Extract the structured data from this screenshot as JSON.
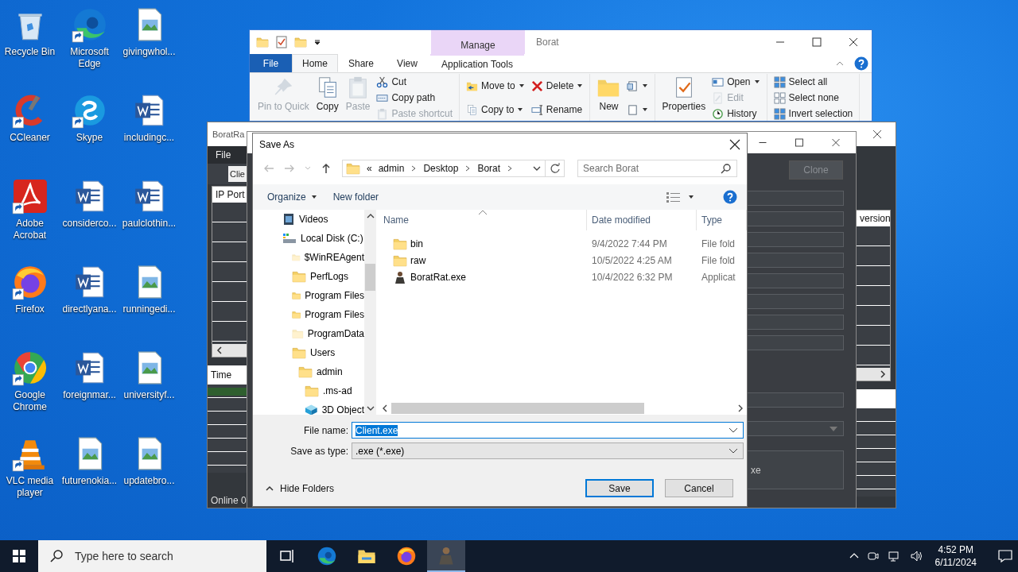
{
  "desktop": {
    "icons": [
      {
        "label": "Recycle Bin",
        "kind": "recycle",
        "shortcut": false
      },
      {
        "label": "Microsoft Edge",
        "kind": "edge",
        "shortcut": true
      },
      {
        "label": "givingwhol...",
        "kind": "image",
        "shortcut": false
      },
      {
        "label": "CCleaner",
        "kind": "ccleaner",
        "shortcut": true
      },
      {
        "label": "Skype",
        "kind": "skype",
        "shortcut": true
      },
      {
        "label": "includingc...",
        "kind": "word",
        "shortcut": false
      },
      {
        "label": "Adobe Acrobat",
        "kind": "acrobat",
        "shortcut": true
      },
      {
        "label": "considerco...",
        "kind": "word",
        "shortcut": false
      },
      {
        "label": "paulclothin...",
        "kind": "word",
        "shortcut": false
      },
      {
        "label": "Firefox",
        "kind": "firefox",
        "shortcut": true
      },
      {
        "label": "directlyana...",
        "kind": "word",
        "shortcut": false
      },
      {
        "label": "runningedi...",
        "kind": "image",
        "shortcut": false
      },
      {
        "label": "Google Chrome",
        "kind": "chrome",
        "shortcut": true
      },
      {
        "label": "foreignmar...",
        "kind": "word",
        "shortcut": false
      },
      {
        "label": "universityf...",
        "kind": "image",
        "shortcut": false
      },
      {
        "label": "VLC media player",
        "kind": "vlc",
        "shortcut": true
      },
      {
        "label": "futurenokia...",
        "kind": "image",
        "shortcut": false
      },
      {
        "label": "updatebro...",
        "kind": "image",
        "shortcut": false
      }
    ]
  },
  "explorer": {
    "title": "Borat",
    "contextual_tab": "Manage",
    "tabs": [
      {
        "label": "File",
        "kind": "file",
        "selected": false
      },
      {
        "label": "Home",
        "kind": "tab",
        "selected": true
      },
      {
        "label": "Share",
        "kind": "tab",
        "selected": false
      },
      {
        "label": "View",
        "kind": "tab",
        "selected": false
      },
      {
        "label": "Application Tools",
        "kind": "contextual",
        "selected": false
      }
    ],
    "ribbon": [
      {
        "columns": [
          {
            "kind": "large",
            "label": "Pin to Quick",
            "disabled": true
          },
          {
            "kind": "large",
            "label": "Copy",
            "disabled": false
          },
          {
            "kind": "large",
            "label": "Paste",
            "disabled": true
          },
          {
            "kind": "stack",
            "items": [
              {
                "label": "Cut",
                "disabled": false,
                "dropdown": false
              },
              {
                "label": "Copy path",
                "disabled": false,
                "dropdown": false
              },
              {
                "label": "Paste shortcut",
                "disabled": true,
                "dropdown": false
              }
            ]
          }
        ]
      },
      {
        "columns": [
          {
            "kind": "stack",
            "items": [
              {
                "label": "Move to",
                "disabled": false,
                "dropdown": true
              },
              {
                "label": "Copy to",
                "disabled": false,
                "dropdown": true
              }
            ]
          },
          {
            "kind": "stack",
            "items": [
              {
                "label": "Delete",
                "disabled": false,
                "dropdown": true
              },
              {
                "label": "Rename",
                "disabled": false,
                "dropdown": false
              }
            ]
          }
        ]
      },
      {
        "columns": [
          {
            "kind": "large",
            "label": "New",
            "disabled": false
          },
          {
            "kind": "stack",
            "items": [
              {
                "disabled": false,
                "dropdown": true
              },
              {
                "disabled": false,
                "dropdown": true
              }
            ]
          }
        ]
      },
      {
        "columns": [
          {
            "kind": "large",
            "label": "Properties",
            "disabled": false
          },
          {
            "kind": "stack",
            "items": [
              {
                "label": "Open",
                "disabled": false,
                "dropdown": true
              },
              {
                "label": "Edit",
                "disabled": true,
                "dropdown": false
              },
              {
                "label": "History",
                "disabled": false,
                "dropdown": false
              }
            ]
          }
        ]
      },
      {
        "columns": [
          {
            "kind": "stack",
            "items": [
              {
                "label": "Select all",
                "disabled": false,
                "dropdown": false
              },
              {
                "label": "Select none",
                "disabled": false,
                "dropdown": false
              },
              {
                "label": "Invert selection",
                "disabled": false,
                "dropdown": false
              }
            ]
          }
        ]
      }
    ]
  },
  "rat_window": {
    "title": "BoratRa",
    "menu": [
      "File"
    ],
    "tab": "Clie",
    "client_columns": [
      "IP Port",
      "version"
    ],
    "log_columns": [
      "Time"
    ],
    "status": "Online 0"
  },
  "builder_window": {
    "clone_button": {
      "label": "Clone",
      "disabled": true
    },
    "fields": [
      {
        "kind": "input"
      },
      {
        "kind": "input"
      },
      {
        "kind": "input"
      },
      {
        "kind": "input"
      },
      {
        "kind": "input"
      },
      {
        "kind": "input"
      },
      {
        "kind": "input"
      },
      {
        "kind": "input"
      },
      {
        "kind": "gap"
      },
      {
        "kind": "input"
      },
      {
        "kind": "select"
      },
      {
        "kind": "textarea",
        "value": "xe"
      }
    ]
  },
  "save_dialog": {
    "title": "Save As",
    "address": {
      "overflow": "«",
      "parts": [
        "admin",
        "Desktop",
        "Borat"
      ]
    },
    "search": {
      "placeholder": "Search Borat"
    },
    "toolbar": {
      "organize": "Organize",
      "new_folder": "New folder"
    },
    "tree": [
      {
        "label": "Videos",
        "kind": "videos",
        "hidden": false
      },
      {
        "label": "Local Disk (C:)",
        "kind": "drive",
        "hidden": false,
        "children": [
          {
            "label": "$WinREAgent",
            "kind": "folder",
            "hidden": true
          },
          {
            "label": "PerfLogs",
            "kind": "folder",
            "hidden": false
          },
          {
            "label": "Program Files",
            "kind": "folder",
            "hidden": false
          },
          {
            "label": "Program Files",
            "kind": "folder",
            "hidden": false
          },
          {
            "label": "ProgramData",
            "kind": "folder",
            "hidden": true
          },
          {
            "label": "Users",
            "kind": "folder",
            "hidden": false,
            "children": [
              {
                "label": "admin",
                "kind": "folder",
                "hidden": false,
                "children": [
                  {
                    "label": ".ms-ad",
                    "kind": "folder",
                    "hidden": false
                  },
                  {
                    "label": "3D Object",
                    "kind": "cube",
                    "hidden": false
                  }
                ]
              }
            ]
          }
        ]
      }
    ],
    "columns": [
      {
        "label": "Name",
        "sorted": true
      },
      {
        "label": "Date modified",
        "sorted": false
      },
      {
        "label": "Type",
        "sorted": false
      }
    ],
    "files": [
      {
        "name": "bin",
        "kind": "folder",
        "date": "9/4/2022 7:44 PM",
        "type": "File fold"
      },
      {
        "name": "raw",
        "kind": "folder",
        "date": "10/5/2022 4:25 AM",
        "type": "File fold"
      },
      {
        "name": "BoratRat.exe",
        "kind": "app",
        "date": "10/4/2022 6:32 PM",
        "type": "Applicat"
      }
    ],
    "file_name": {
      "label": "File name:",
      "value": "Client.exe",
      "value_selected": true
    },
    "save_type": {
      "label": "Save as type:",
      "value": ".exe (*.exe)"
    },
    "hide_folders": "Hide Folders",
    "buttons": [
      {
        "label": "Save",
        "default": true
      },
      {
        "label": "Cancel",
        "default": false
      }
    ]
  },
  "taskbar": {
    "search_placeholder": "Type here to search",
    "apps": [
      {
        "kind": "taskview",
        "selected": false
      },
      {
        "kind": "edge",
        "selected": false
      },
      {
        "kind": "explorer",
        "selected": false
      },
      {
        "kind": "firefox",
        "selected": false
      },
      {
        "kind": "rat",
        "selected": true
      }
    ],
    "time": "4:52 PM",
    "date": "6/11/2024"
  }
}
